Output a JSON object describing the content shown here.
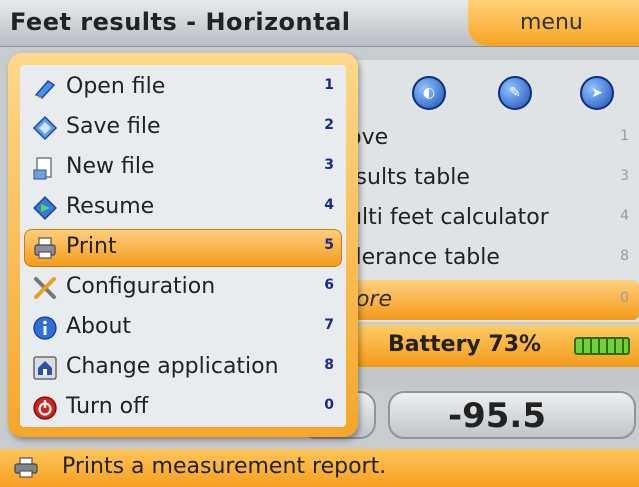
{
  "header": {
    "title": "Feet results - Horizontal",
    "menu_label": "menu"
  },
  "background": {
    "icons": [
      "measure-m-icon",
      "gauge-icon",
      "tool-icon",
      "settings-icon"
    ],
    "rows": [
      {
        "label": "love",
        "num": "1"
      },
      {
        "label": "esults table",
        "num": "3"
      },
      {
        "label": "lulti feet calculator",
        "num": "4"
      },
      {
        "label": "olerance table",
        "num": "8"
      },
      {
        "label": "nore",
        "num": "0"
      }
    ],
    "battery_text": "Battery 73%",
    "value": "-95.5"
  },
  "popup": {
    "items": [
      {
        "label": "Open file",
        "num": "1",
        "icon": "open-file-icon"
      },
      {
        "label": "Save file",
        "num": "2",
        "icon": "save-file-icon"
      },
      {
        "label": "New file",
        "num": "3",
        "icon": "new-file-icon"
      },
      {
        "label": "Resume",
        "num": "4",
        "icon": "resume-icon"
      },
      {
        "label": "Print",
        "num": "5",
        "icon": "printer-icon"
      },
      {
        "label": "Configuration",
        "num": "6",
        "icon": "tools-icon"
      },
      {
        "label": "About",
        "num": "7",
        "icon": "info-icon"
      },
      {
        "label": "Change application",
        "num": "8",
        "icon": "home-icon"
      },
      {
        "label": "Turn off",
        "num": "0",
        "icon": "power-icon"
      }
    ],
    "selected_index": 4
  },
  "status": {
    "text": "Prints a measurement report."
  },
  "colors": {
    "accent": "#f39a18",
    "accent_light": "#ffd080",
    "panel": "#e9ecee"
  }
}
